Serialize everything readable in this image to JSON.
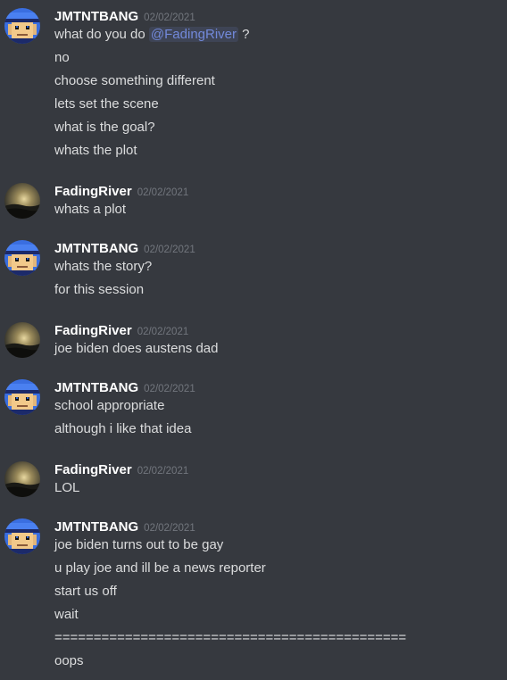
{
  "colors": {
    "background": "#36393f",
    "text": "#dcddde",
    "username": "#ffffff",
    "timestamp": "#72767d",
    "mention": "#7289da"
  },
  "groups": [
    {
      "author": "JMTNTBANG",
      "avatar": "pixel-face-blue-cap",
      "timestamp": "02/02/2021",
      "lines": [
        {
          "pre": "what do you do ",
          "mention": "@FadingRiver",
          "post": " ?"
        },
        {
          "text": "no"
        },
        {
          "text": "choose something different"
        },
        {
          "text": "lets set the scene"
        },
        {
          "text": "what is the goal?"
        },
        {
          "text": "whats the plot"
        }
      ]
    },
    {
      "author": "FadingRiver",
      "avatar": "sunset-landscape",
      "timestamp": "02/02/2021",
      "lines": [
        {
          "text": "whats a plot"
        }
      ]
    },
    {
      "author": "JMTNTBANG",
      "avatar": "pixel-face-blue-cap",
      "timestamp": "02/02/2021",
      "lines": [
        {
          "text": "whats the story?"
        },
        {
          "text": "for this session"
        }
      ]
    },
    {
      "author": "FadingRiver",
      "avatar": "sunset-landscape",
      "timestamp": "02/02/2021",
      "lines": [
        {
          "text": "joe biden does austens dad"
        }
      ]
    },
    {
      "author": "JMTNTBANG",
      "avatar": "pixel-face-blue-cap",
      "timestamp": "02/02/2021",
      "lines": [
        {
          "text": "school appropriate"
        },
        {
          "text": "although i like that idea"
        }
      ]
    },
    {
      "author": "FadingRiver",
      "avatar": "sunset-landscape",
      "timestamp": "02/02/2021",
      "lines": [
        {
          "text": "LOL"
        }
      ]
    },
    {
      "author": "JMTNTBANG",
      "avatar": "pixel-face-blue-cap",
      "timestamp": "02/02/2021",
      "lines": [
        {
          "text": "joe biden turns out to be gay"
        },
        {
          "text": "u play joe and ill be a news reporter"
        },
        {
          "text": "start us off"
        },
        {
          "text": "wait"
        },
        {
          "text": "============================================="
        },
        {
          "text": "oops"
        }
      ]
    }
  ]
}
